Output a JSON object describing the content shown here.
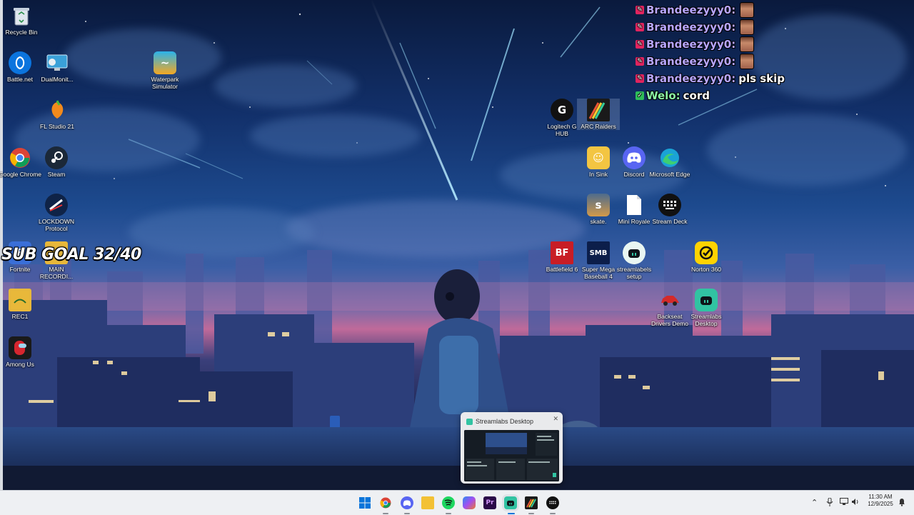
{
  "desktop": {
    "icons": [
      {
        "label": "Recycle Bin",
        "icon": "recycle-bin-icon"
      },
      {
        "label": "Battle.net",
        "icon": "battlenet-icon"
      },
      {
        "label": "DualMonit...",
        "icon": "monitor-icon"
      },
      {
        "label": "Waterpark Simulator",
        "icon": "waterpark-icon"
      },
      {
        "label": "FL Studio 21",
        "icon": "fl-studio-icon"
      },
      {
        "label": "Google Chrome",
        "icon": "chrome-icon"
      },
      {
        "label": "Steam",
        "icon": "steam-icon"
      },
      {
        "label": "LOCKDOWN Protocol",
        "icon": "lockdown-icon"
      },
      {
        "label": "Fortnite",
        "icon": "fortnite-icon"
      },
      {
        "label": "MAIN RECORDI...",
        "icon": "folder-icon"
      },
      {
        "label": "REC1",
        "icon": "folder-icon"
      },
      {
        "label": "Among Us",
        "icon": "among-us-icon"
      },
      {
        "label": "Logitech G HUB",
        "icon": "logitech-icon"
      },
      {
        "label": "ARC Raiders",
        "icon": "arc-raiders-icon"
      },
      {
        "label": "In Sink",
        "icon": "in-sink-icon"
      },
      {
        "label": "Discord",
        "icon": "discord-icon"
      },
      {
        "label": "Microsoft Edge",
        "icon": "edge-icon"
      },
      {
        "label": "skate.",
        "icon": "skate-icon"
      },
      {
        "label": "Mini Royale",
        "icon": "file-icon"
      },
      {
        "label": "Stream Deck",
        "icon": "stream-deck-icon"
      },
      {
        "label": "Battlefield 6",
        "icon": "battlefield-icon"
      },
      {
        "label": "Super Mega Baseball 4",
        "icon": "baseball-icon"
      },
      {
        "label": "streamlabels setup",
        "icon": "streamlabs-icon"
      },
      {
        "label": "Norton 360",
        "icon": "norton-icon"
      },
      {
        "label": "Backseat Drivers Demo",
        "icon": "car-icon"
      },
      {
        "label": "Streamlabs Desktop",
        "icon": "streamlabs-icon"
      }
    ]
  },
  "overlay": {
    "sub_goal": "SUB GOAL 32/40",
    "chat": [
      {
        "user": "Brandeezyyy0:",
        "message": "",
        "emote": true,
        "badge": "red"
      },
      {
        "user": "Brandeezyyy0:",
        "message": "",
        "emote": true,
        "badge": "red"
      },
      {
        "user": "Brandeezyyy0:",
        "message": "",
        "emote": true,
        "badge": "red"
      },
      {
        "user": "Brandeezyyy0:",
        "message": "",
        "emote": true,
        "badge": "red"
      },
      {
        "user": "Brandeezyyy0:",
        "message": "pls skip",
        "emote": false,
        "badge": "red"
      },
      {
        "user": "Welo:",
        "message": "cord",
        "emote": false,
        "badge": "green"
      }
    ]
  },
  "taskbar_preview": {
    "title": "Streamlabs Desktop"
  },
  "taskbar": {
    "apps": [
      {
        "name": "start-icon"
      },
      {
        "name": "chrome-icon"
      },
      {
        "name": "discord-icon"
      },
      {
        "name": "file-explorer-icon"
      },
      {
        "name": "spotify-icon"
      },
      {
        "name": "copilot-icon"
      },
      {
        "name": "premiere-icon",
        "label": "Pr"
      },
      {
        "name": "streamlabs-icon"
      },
      {
        "name": "arc-raiders-icon"
      },
      {
        "name": "stream-deck-icon"
      }
    ],
    "time": "11:30 AM",
    "date": "12/9/2025"
  },
  "colors": {
    "chat_user_purple": "#b8a6ff",
    "chat_user_green": "#8cf5a5",
    "taskbar_bg": "#eef0f3",
    "streamlabs_accent": "#31c3a2"
  }
}
